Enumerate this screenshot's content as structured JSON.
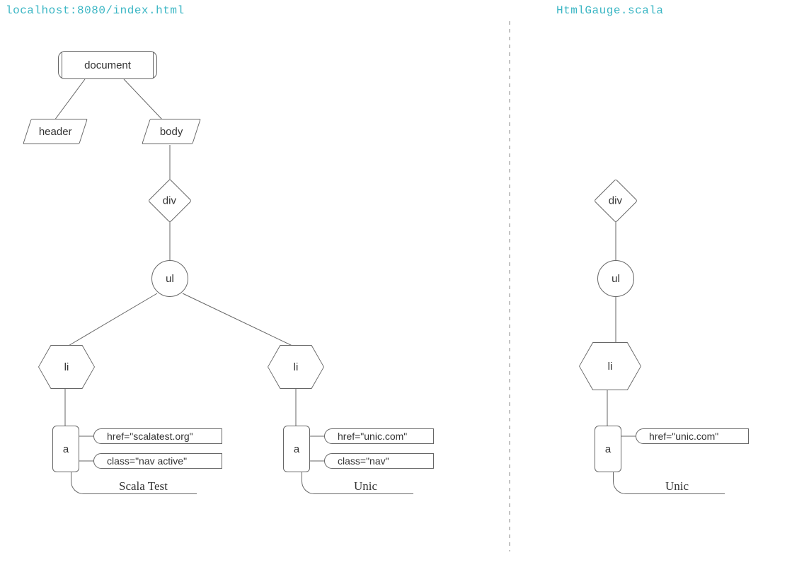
{
  "left": {
    "title": "localhost:8080/index.html",
    "nodes": {
      "document": "document",
      "header": "header",
      "body": "body",
      "div": "div",
      "ul": "ul",
      "li1": "li",
      "li2": "li",
      "a1": "a",
      "a2": "a"
    },
    "attrs": {
      "a1_href": "href=\"scalatest.org\"",
      "a1_class": "class=\"nav active\"",
      "a2_href": "href=\"unic.com\"",
      "a2_class": "class=\"nav\""
    },
    "texts": {
      "a1_text": "Scala Test",
      "a2_text": "Unic"
    }
  },
  "right": {
    "title": "HtmlGauge.scala",
    "nodes": {
      "div": "div",
      "ul": "ul",
      "li": "li",
      "a": "a"
    },
    "attrs": {
      "a_href": "href=\"unic.com\""
    },
    "texts": {
      "a_text": "Unic"
    }
  }
}
